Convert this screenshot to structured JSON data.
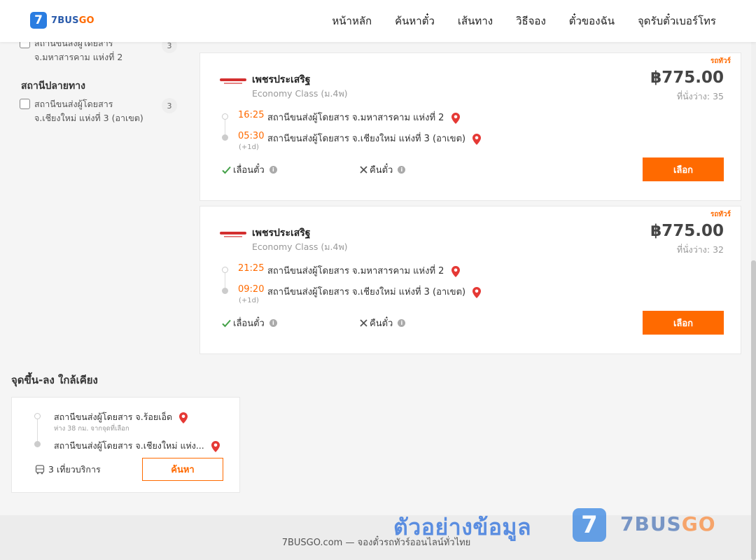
{
  "header": {
    "logo_badge": "7",
    "logo_brand": "7BUS",
    "logo_brand_go": "GO",
    "nav": [
      "หน้าหลัก",
      "ค้นหาตั๋ว",
      "เส้นทาง",
      "วิธีจอง",
      "ตั๋วของฉัน",
      "จุดรับตั๋วเบอร์โทร"
    ]
  },
  "sidebar": {
    "origin_partial": {
      "label_line1": "สถานีขนส่งผู้โดยสาร",
      "label_line2": "จ.มหาสารคาม แห่งที่ 2",
      "count": "3"
    },
    "destination_heading": "สถานีปลายทาง",
    "destination_item": {
      "label_line1": "สถานีขนส่งผู้โดยสาร",
      "label_line2": "จ.เชียงใหม่ แห่งที่ 3 (อาเขต)",
      "count": "3"
    }
  },
  "trips": [
    {
      "tag": "รถทัวร์",
      "operator": "เพชรประเสริฐ",
      "class": "Economy Class (ม.4พ)",
      "price": "฿775.00",
      "seats": "ที่นั่งว่าง: 35",
      "dep_time": "16:25",
      "dep_station": "สถานีขนส่งผู้โดยสาร จ.มหาสารคาม แห่งที่ 2",
      "arr_time": "05:30",
      "arr_station": "สถานีขนส่งผู้โดยสาร จ.เชียงใหม่ แห่งที่ 3 (อาเขต)",
      "day_offset": "(+1d)",
      "change_label": "เลื่อนตั๋ว",
      "refund_label": "คืนตั๋ว",
      "select_label": "เลือก"
    },
    {
      "tag": "รถทัวร์",
      "operator": "เพชรประเสริฐ",
      "class": "Economy Class (ม.4พ)",
      "price": "฿775.00",
      "seats": "ที่นั่งว่าง: 32",
      "dep_time": "21:25",
      "dep_station": "สถานีขนส่งผู้โดยสาร จ.มหาสารคาม แห่งที่ 2",
      "arr_time": "09:20",
      "arr_station": "สถานีขนส่งผู้โดยสาร จ.เชียงใหม่ แห่งที่ 3 (อาเขต)",
      "day_offset": "(+1d)",
      "change_label": "เลื่อนตั๋ว",
      "refund_label": "คืนตั๋ว",
      "select_label": "เลือก"
    }
  ],
  "nearby": {
    "title": "จุดขึ้น-ลง ใกล้เคียง",
    "from_station": "สถานีขนส่งผู้โดยสาร จ.ร้อยเอ็ด",
    "from_distance": "ห่าง 38 กม. จากจุดที่เลือก",
    "to_station": "สถานีขนส่งผู้โดยสาร จ.เชียงใหม่ แห่ง...",
    "trips_label": "3 เที่ยวบริการ",
    "search_label": "ค้นหา"
  },
  "footer": {
    "text": "7BUSGO.com — จองตั๋วรถทัวร์ออนไลน์ทั่วไทย",
    "watermark_text": "ตัวอย่างข้อมูล",
    "watermark_badge": "7",
    "watermark_brand": "7BUS",
    "watermark_brand_go": "GO"
  },
  "colors": {
    "accent": "#ff6a00",
    "brand_blue": "#2a7de1",
    "pin_red": "#e53935",
    "check_green": "#43a047"
  }
}
